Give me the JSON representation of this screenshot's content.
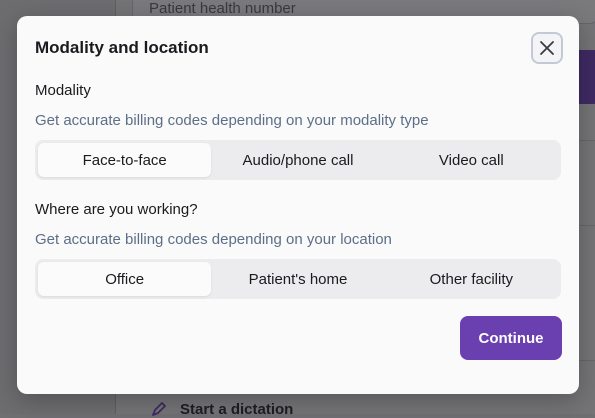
{
  "background": {
    "field_label": "Patient health number",
    "dictation_label": "Start a dictation"
  },
  "modal": {
    "title": "Modality and location",
    "close_icon": "close-icon",
    "modality": {
      "label": "Modality",
      "description": "Get accurate billing codes depending on your modality type",
      "options": [
        "Face-to-face",
        "Audio/phone call",
        "Video call"
      ],
      "selected": "Face-to-face"
    },
    "location": {
      "label": "Where are you working?",
      "description": "Get accurate billing codes depending on your location",
      "options": [
        "Office",
        "Patient's home",
        "Other facility"
      ],
      "selected": "Office"
    },
    "continue_label": "Continue"
  },
  "colors": {
    "accent": "#6a40b0",
    "description_text": "#5c6f86"
  }
}
